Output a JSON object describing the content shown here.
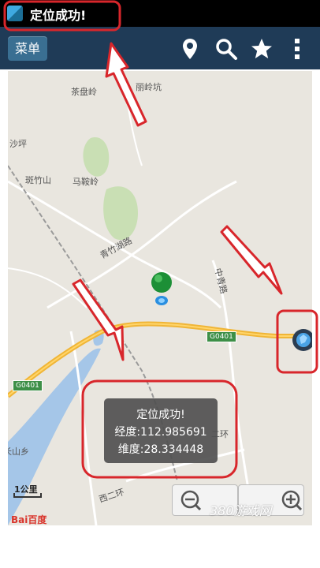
{
  "status_bar": {
    "text": "定位成功!"
  },
  "toolbar": {
    "menu_label": "菜单",
    "icons": [
      "location-pin-icon",
      "search-icon",
      "star-icon",
      "overflow-menu-icon"
    ]
  },
  "map": {
    "place_labels": [
      "茶盘岭",
      "丽岭坑",
      "沙坪",
      "斑竹山",
      "马鞍岭",
      "青竹湖路",
      "中青路",
      "长山乡",
      "西二环",
      "二环"
    ],
    "road_labels": [
      "G0401",
      "G0401"
    ],
    "popup": {
      "title": "定位成功!",
      "longitude": "经度:112.985691",
      "latitude": "维度:28.334448"
    },
    "scale_label": "1公里",
    "baidu_logo": "Bai百度",
    "watermark": "380游戏网"
  },
  "colors": {
    "toolbar": "#1f3b57",
    "menu_button": "#3a6f92",
    "annotation": "#d8262b",
    "highway": "#f0b536"
  }
}
